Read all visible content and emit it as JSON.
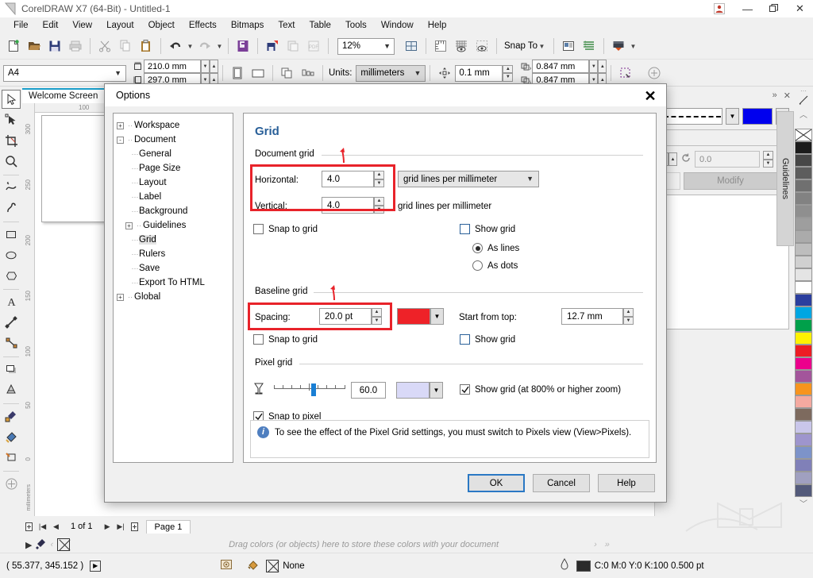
{
  "titlebar": {
    "title": "CorelDRAW X7 (64-Bit) - Untitled-1",
    "logo_icon": "coreldraw-logo-icon",
    "avatar_icon": "user-avatar-icon",
    "minimize": "—",
    "restore": "❐",
    "close": "✕"
  },
  "menubar": {
    "items": [
      {
        "label": "File"
      },
      {
        "label": "Edit"
      },
      {
        "label": "View"
      },
      {
        "label": "Layout"
      },
      {
        "label": "Object"
      },
      {
        "label": "Effects"
      },
      {
        "label": "Bitmaps"
      },
      {
        "label": "Text"
      },
      {
        "label": "Table"
      },
      {
        "label": "Tools"
      },
      {
        "label": "Window"
      },
      {
        "label": "Help"
      }
    ]
  },
  "toolbar": {
    "zoom_level": "12%",
    "snap_to_label": "Snap To",
    "icons": [
      "new-document-icon",
      "open-icon",
      "save-icon",
      "print-icon",
      "cut-icon",
      "copy-icon",
      "paste-icon",
      "undo-icon",
      "redo-icon",
      "import-icon",
      "export-icon",
      "publish-pdf-icon",
      "corel-connect-icon",
      "full-screen-preview-icon",
      "show-rulers-icon",
      "show-grid-icon",
      "show-guidelines-icon",
      "options-icon",
      "object-manager-icon",
      "application-launcher-icon"
    ]
  },
  "propertybar": {
    "page_preset": "A4",
    "page_width": "210.0 mm",
    "page_height": "297.0 mm",
    "units_label": "Units:",
    "units_value": "millimeters",
    "nudge_offset": "0.1 mm",
    "duplicate_x": "0.847 mm",
    "duplicate_y": "0.847 mm",
    "portrait_icon": "portrait-orientation-icon",
    "landscape_icon": "landscape-orientation-icon",
    "all_pages_icon": "all-pages-icon",
    "current_page_icon": "current-page-icon",
    "edit_area_icon": "edit-area-icon"
  },
  "document_tab": {
    "label": "Welcome Screen"
  },
  "toolbox": {
    "tools": [
      {
        "name": "pick-tool",
        "selected": true
      },
      {
        "name": "shape-tool",
        "selected": false
      },
      {
        "name": "crop-tool",
        "selected": false
      },
      {
        "name": "zoom-tool",
        "selected": false
      },
      {
        "name": "freehand-tool",
        "selected": false
      },
      {
        "name": "smart-fill-tool",
        "selected": false
      },
      {
        "name": "rectangle-tool",
        "selected": false
      },
      {
        "name": "ellipse-tool",
        "selected": false
      },
      {
        "name": "polygon-tool",
        "selected": false
      },
      {
        "name": "text-tool",
        "selected": false
      },
      {
        "name": "parallel-dimension-tool",
        "selected": false
      },
      {
        "name": "straight-line-connector-tool",
        "selected": false
      },
      {
        "name": "drop-shadow-tool",
        "selected": false
      },
      {
        "name": "transparency-tool",
        "selected": false
      },
      {
        "name": "color-eyedropper-tool",
        "selected": false
      },
      {
        "name": "interactive-fill-tool",
        "selected": false
      },
      {
        "name": "outline-tool",
        "selected": false
      },
      {
        "name": "quick-customize-tool",
        "selected": false
      }
    ]
  },
  "rulers": {
    "unit_label": "millimeters",
    "vertical_ticks": [
      "300",
      "250",
      "200",
      "150",
      "100",
      "50",
      "0"
    ],
    "horizontal_ticks": [
      "100"
    ]
  },
  "docker": {
    "guidelines_tab": "Guidelines",
    "rotation_value": "0.0",
    "modify_label": "Modify",
    "line_style_icon": "dashed-line-style-icon",
    "line_color": "#0000ee",
    "collapse_icon": "collapse-docker-icon",
    "close_icon": "close-docker-icon"
  },
  "pagenav": {
    "page_indicator": "1 of 1",
    "page_tab": "Page 1",
    "add_page_before_icon": "add-page-before-icon",
    "first_page_icon": "first-page-icon",
    "prev_page_icon": "previous-page-icon",
    "next_page_icon": "next-page-icon",
    "last_page_icon": "last-page-icon",
    "add_page_after_icon": "add-page-after-icon"
  },
  "colorbar": {
    "hint": "Drag colors (or objects) here to store these colors with your document",
    "no_color_icon": "no-color-icon",
    "eyedropper_icon": "eyedropper-icon"
  },
  "statusbar": {
    "coordinates": "( 55.377, 345.152 )",
    "fill_label": "None",
    "outline_info": "C:0 M:0 Y:0 K:100  0.500 pt",
    "fill_icon": "fill-color-icon",
    "outline_icon": "outline-pen-icon",
    "snapshot_icon": "document-palette-icon"
  },
  "dialog": {
    "title": "Options",
    "close_label": "✕",
    "tree": [
      {
        "label": "Workspace",
        "expander": "+",
        "indent": 0,
        "selected": false
      },
      {
        "label": "Document",
        "expander": "-",
        "indent": 0,
        "selected": false
      },
      {
        "label": "General",
        "expander": "",
        "indent": 1,
        "selected": false
      },
      {
        "label": "Page Size",
        "expander": "",
        "indent": 1,
        "selected": false
      },
      {
        "label": "Layout",
        "expander": "",
        "indent": 1,
        "selected": false
      },
      {
        "label": "Label",
        "expander": "",
        "indent": 1,
        "selected": false
      },
      {
        "label": "Background",
        "expander": "",
        "indent": 1,
        "selected": false
      },
      {
        "label": "Guidelines",
        "expander": "+",
        "indent": 1,
        "selected": false
      },
      {
        "label": "Grid",
        "expander": "",
        "indent": 1,
        "selected": true
      },
      {
        "label": "Rulers",
        "expander": "",
        "indent": 1,
        "selected": false
      },
      {
        "label": "Save",
        "expander": "",
        "indent": 1,
        "selected": false
      },
      {
        "label": "Export To HTML",
        "expander": "",
        "indent": 1,
        "selected": false
      },
      {
        "label": "Global",
        "expander": "+",
        "indent": 0,
        "selected": false
      }
    ],
    "page_title": "Grid",
    "document_grid": {
      "group_label": "Document grid",
      "horizontal_label": "Horizontal:",
      "horizontal_value": "4.0",
      "horizontal_unit": "grid lines per millimeter",
      "vertical_label": "Vertical:",
      "vertical_value": "4.0",
      "vertical_unit": "grid lines per millimeter",
      "snap_label": "Snap to grid",
      "snap_checked": false,
      "show_label": "Show grid",
      "show_checked": false,
      "as_lines_label": "As lines",
      "as_dots_label": "As dots",
      "display_mode": "As lines"
    },
    "baseline_grid": {
      "group_label": "Baseline grid",
      "spacing_label": "Spacing:",
      "spacing_value": "20.0 pt",
      "color": "#ee2228",
      "start_label": "Start from top:",
      "start_value": "12.7 mm",
      "snap_label": "Snap to grid",
      "snap_checked": false,
      "show_label": "Show grid",
      "show_checked": false
    },
    "pixel_grid": {
      "group_label": "Pixel grid",
      "opacity_value": "60.0",
      "color": "#d9d9f7",
      "show_label": "Show grid (at 800% or higher zoom)",
      "show_checked": true,
      "snap_label": "Snap to pixel",
      "snap_checked": true,
      "transparency_icon": "transparency-icon"
    },
    "info_text": "To see the effect of the Pixel Grid settings, you must switch to Pixels view (View>Pixels).",
    "buttons": {
      "ok": "OK",
      "cancel": "Cancel",
      "help": "Help"
    }
  },
  "palette": {
    "colors": [
      "#1c1c1c",
      "#474747",
      "#5d5d5d",
      "#707070",
      "#828282",
      "#8f8f8f",
      "#9e9e9e",
      "#ababab",
      "#bdbdbd",
      "#d0d0d0",
      "#e4e4e4",
      "#ffffff",
      "#2b3e9e",
      "#00a6e2",
      "#00a04a",
      "#fff200",
      "#ed1c24",
      "#ec008c",
      "#a3559b",
      "#f7941e",
      "#f4a9a0",
      "#7d6a5e",
      "#c9c6ea",
      "#9e95cd",
      "#7d93c9",
      "#8080b8",
      "#a0a0c0",
      "#535a7a"
    ]
  }
}
